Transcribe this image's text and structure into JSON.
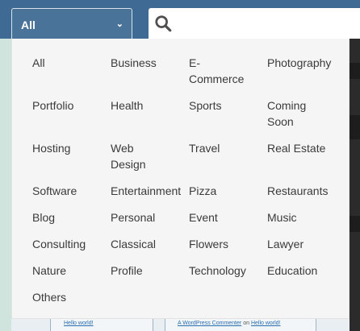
{
  "category_select": {
    "value": "All",
    "caret": "⌄"
  },
  "search": {
    "value": "",
    "placeholder": ""
  },
  "background": {
    "link_left": "Hello world!",
    "comment_prefix": "A WordPress Commenter",
    "comment_on": "on",
    "link_right": "Hello world!"
  },
  "categories": [
    [
      "All",
      "Business",
      "E-\nCommerce",
      "Photography"
    ],
    [
      "Portfolio",
      "Health",
      "Sports",
      "Coming\nSoon"
    ],
    [
      "Hosting",
      "Web\nDesign",
      "Travel",
      "Real Estate"
    ],
    [
      "Software",
      "Entertainment",
      "Pizza",
      "Restaurants"
    ],
    [
      "Blog",
      "Personal",
      "Event",
      "Music"
    ],
    [
      "Consulting",
      "Classical",
      "Flowers",
      "Lawyer"
    ],
    [
      "Nature",
      "Profile",
      "Technology",
      "Education"
    ],
    [
      "Others"
    ]
  ]
}
